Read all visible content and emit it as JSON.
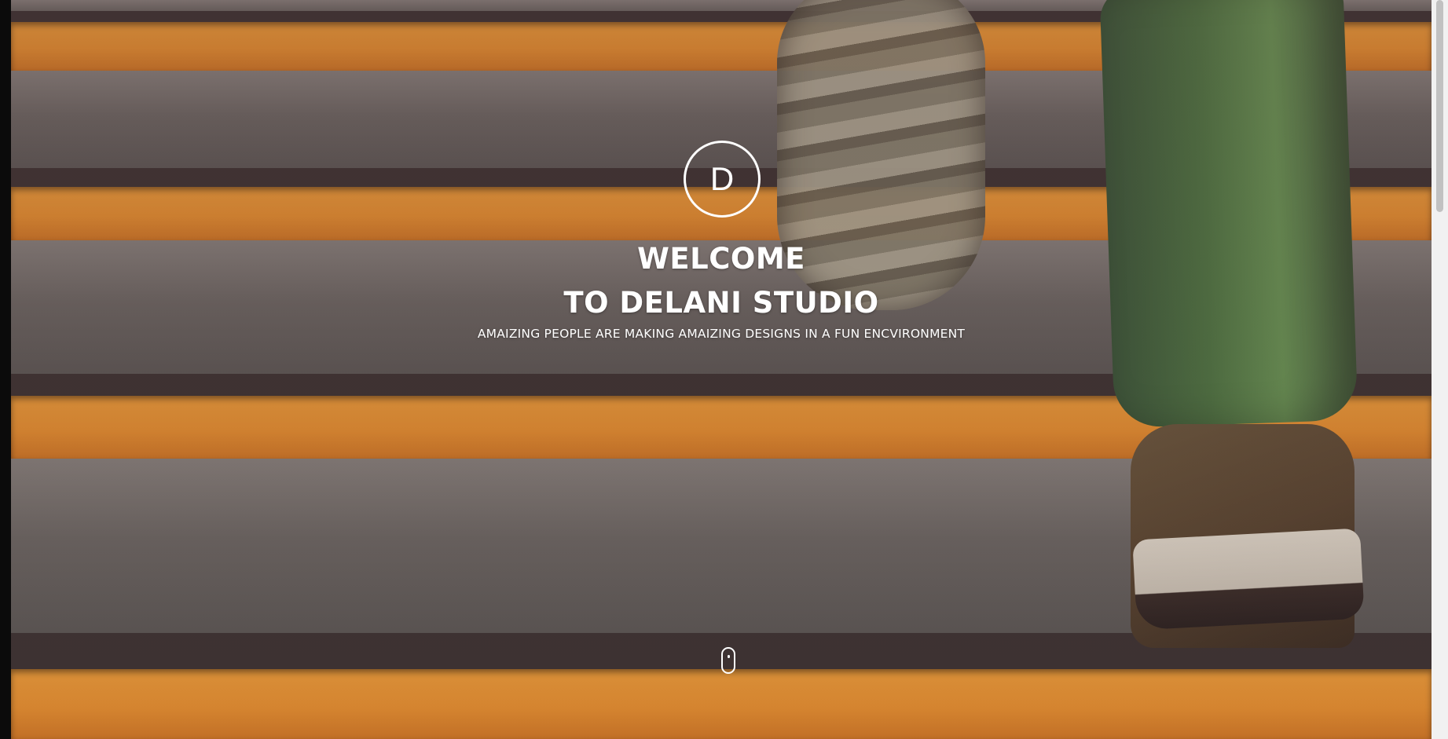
{
  "hero": {
    "logo_letter": "D",
    "title_line1": "WELCOME",
    "title_line2": "TO DELANI STUDIO",
    "subtitle": "AMAIZING PEOPLE ARE MAKING AMAIZING DESIGNS IN A FUN ENCVIRONMENT"
  },
  "icons": {
    "scroll_indicator": "mouse-scroll-icon"
  },
  "colors": {
    "accent_orange": "#f09530",
    "text": "#ffffff",
    "stair_gray": "#6e6a66"
  }
}
